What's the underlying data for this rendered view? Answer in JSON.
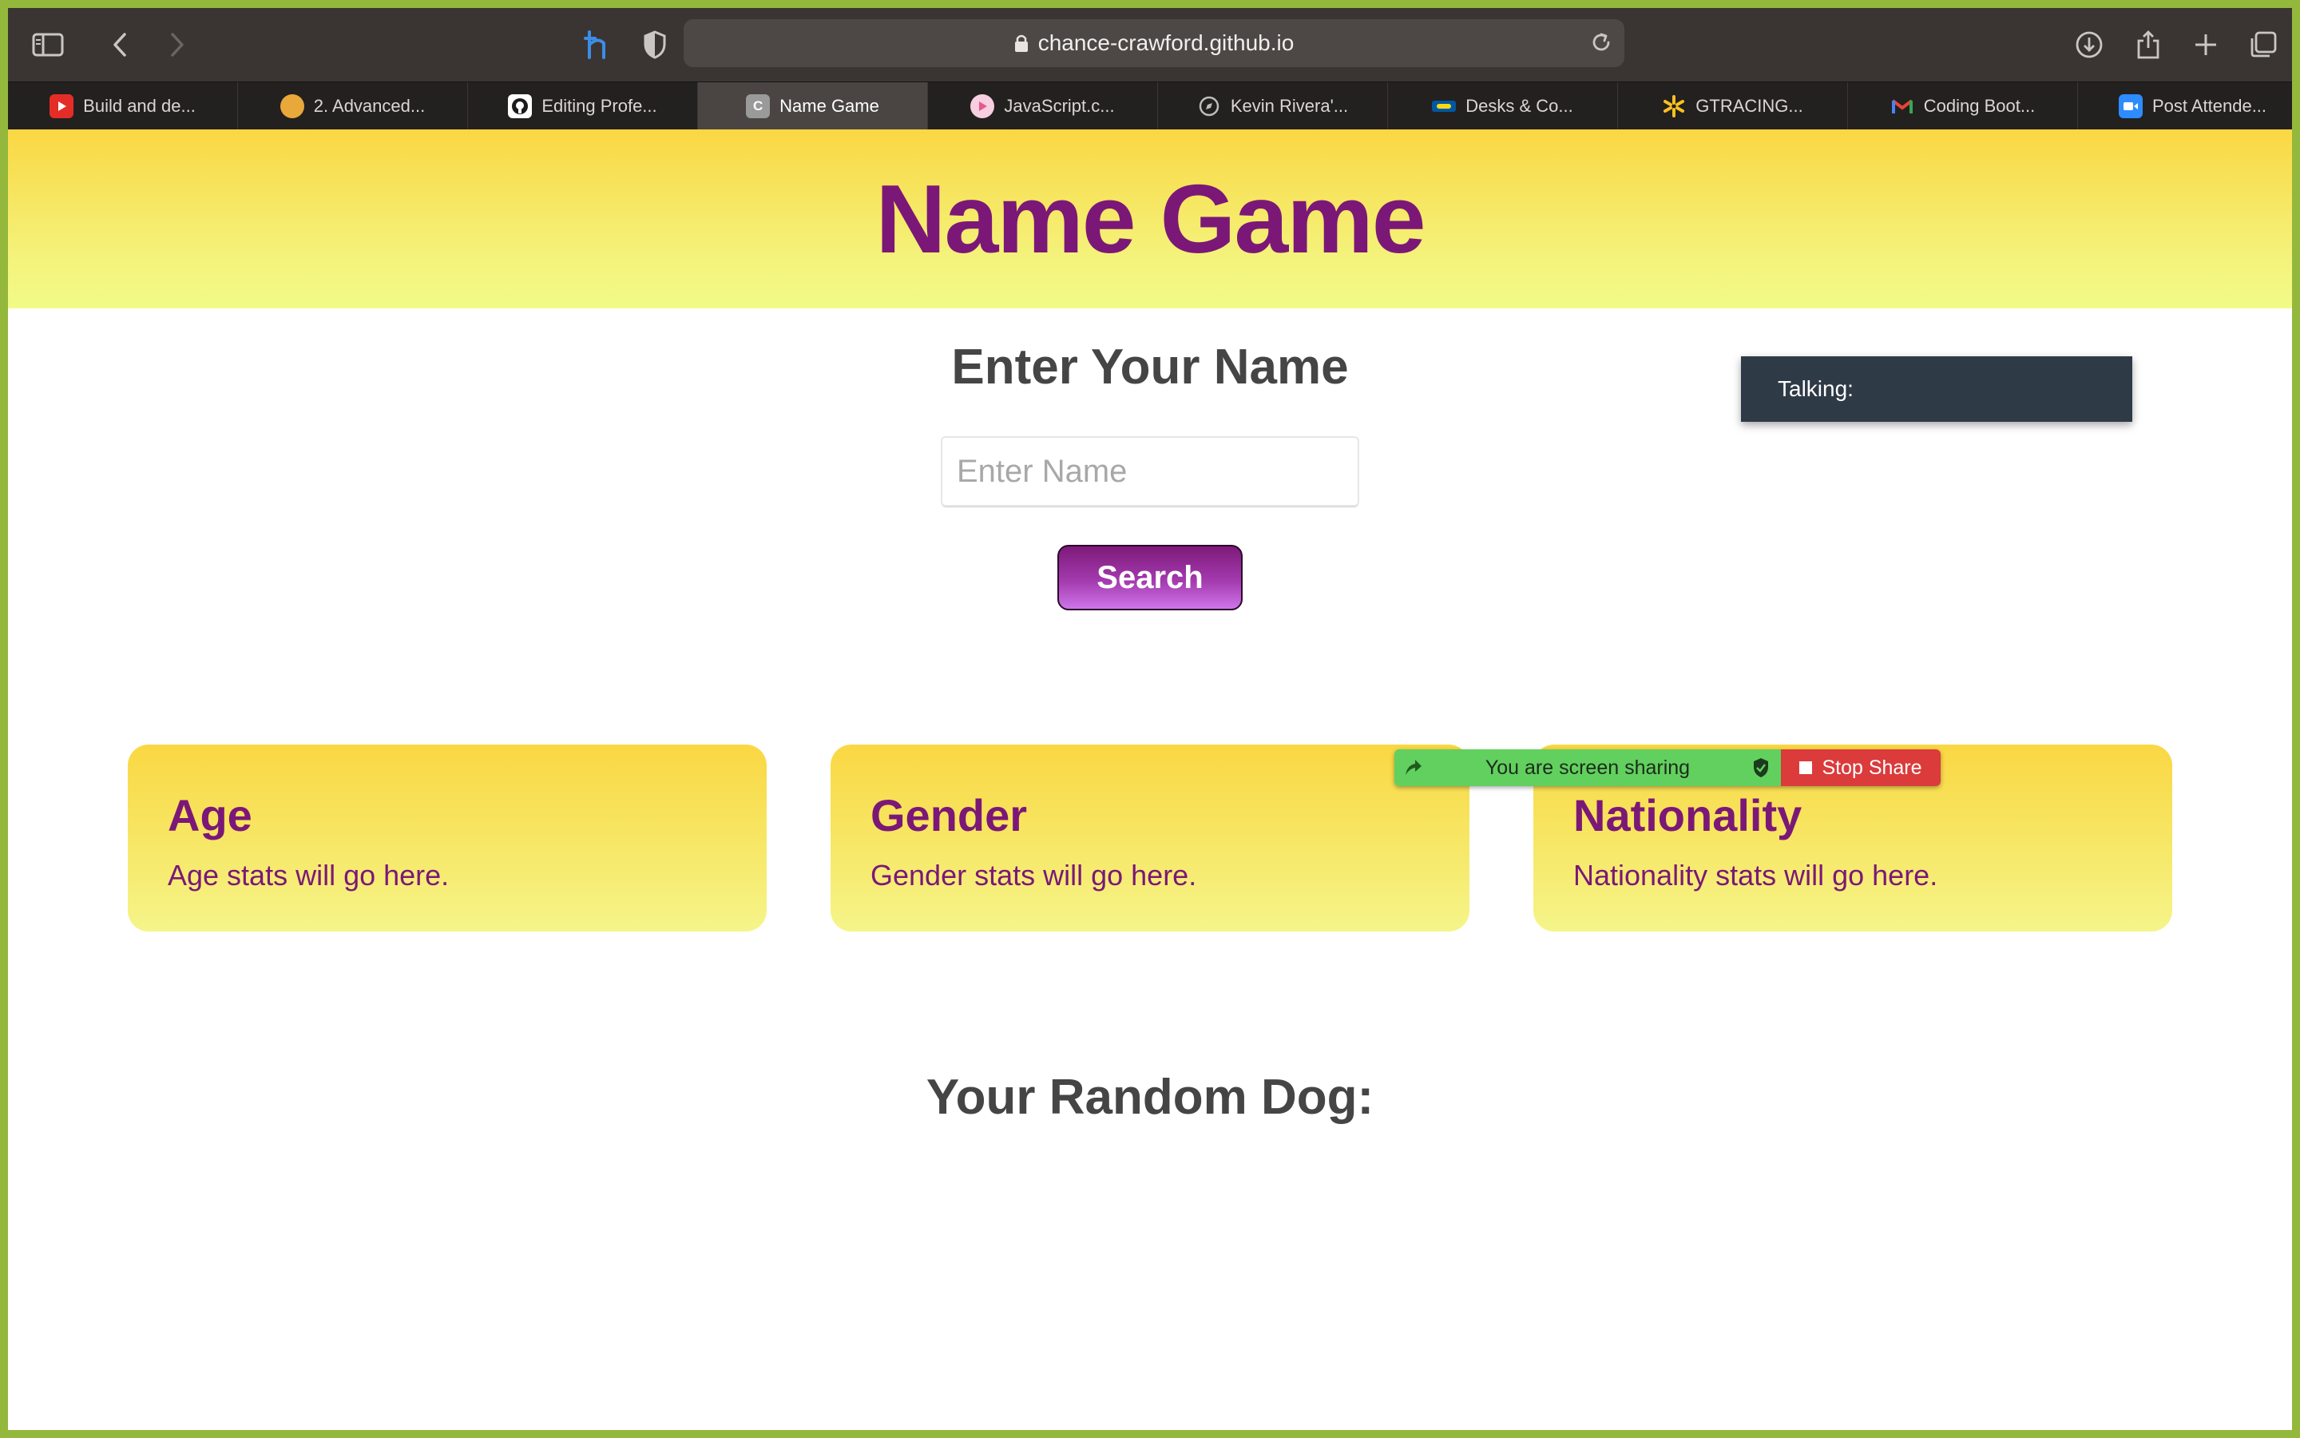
{
  "browser": {
    "url": "chance-crawford.github.io",
    "tabs": [
      {
        "label": "Build and de...",
        "icon": "youtube-icon",
        "color": "#e52d27"
      },
      {
        "label": "2. Advanced...",
        "icon": "course-icon",
        "color": "#e9a83a"
      },
      {
        "label": "Editing Profe...",
        "icon": "github-icon",
        "color": "#ffffff"
      },
      {
        "label": "Name Game",
        "icon": "c-letter-icon",
        "color": "#9a9a9a",
        "active": true
      },
      {
        "label": "JavaScript.c...",
        "icon": "play-icon",
        "color": "#e6568f"
      },
      {
        "label": "Kevin Rivera'...",
        "icon": "compass-icon",
        "color": "#bdbdbd"
      },
      {
        "label": "Desks & Co...",
        "icon": "ikea-icon",
        "color": "#0058a3"
      },
      {
        "label": "GTRACING...",
        "icon": "walmart-spark-icon",
        "color": "#f9c020"
      },
      {
        "label": "Coding Boot...",
        "icon": "gmail-icon",
        "color": "#ea4335"
      },
      {
        "label": "Post Attende...",
        "icon": "zoom-icon",
        "color": "#2d8cff"
      }
    ],
    "tab_fav_letters": {
      "c_letter": "C"
    }
  },
  "page": {
    "title": "Name Game",
    "subtitle": "Enter Your Name",
    "input_placeholder": "Enter Name",
    "search_label": "Search",
    "cards": [
      {
        "title": "Age",
        "text": "Age stats will go here."
      },
      {
        "title": "Gender",
        "text": "Gender stats will go here."
      },
      {
        "title": "Nationality",
        "text": "Nationality stats will go here."
      }
    ],
    "dog_title": "Your Random Dog:"
  },
  "overlays": {
    "talking_label": "Talking:",
    "share_status": "You are screen sharing",
    "stop_share_label": "Stop Share"
  },
  "colors": {
    "accent_purple": "#7b1877",
    "hero_yellow": "#fad743",
    "screen_share_green": "#62d05e",
    "stop_red": "#db3b3b",
    "window_border": "#93b83c"
  }
}
